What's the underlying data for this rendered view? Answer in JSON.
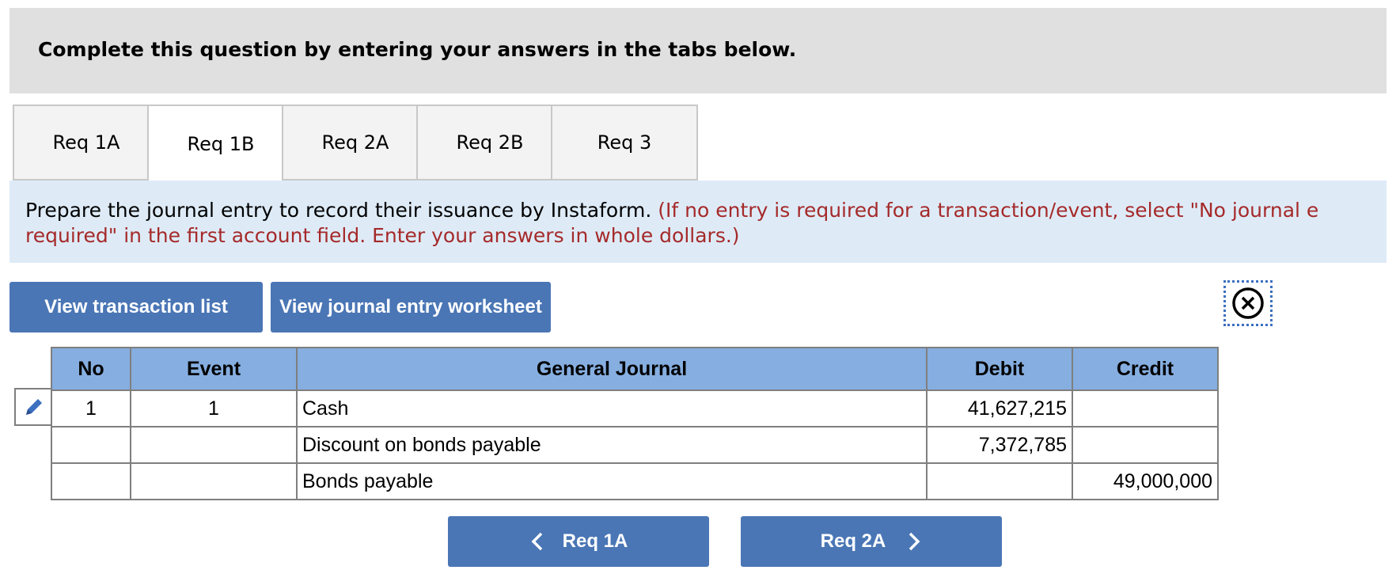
{
  "header": {
    "title": "Complete this question by entering your answers in the tabs below."
  },
  "tabs": [
    {
      "label": "Req 1A",
      "active": false
    },
    {
      "label": "Req 1B",
      "active": true
    },
    {
      "label": "Req 2A",
      "active": false
    },
    {
      "label": "Req 2B",
      "active": false
    },
    {
      "label": "Req 3",
      "active": false
    }
  ],
  "instructions": {
    "main": "Prepare the journal entry to record their issuance by Instaform.",
    "note_line1": "(If no entry is required for a transaction/event, select \"No journal e",
    "note_line2": "required\" in the first account field. Enter your answers in whole dollars.)"
  },
  "buttons": {
    "view_transaction_list": "View transaction list",
    "view_journal_worksheet": "View journal entry worksheet"
  },
  "table": {
    "headers": [
      "No",
      "Event",
      "General Journal",
      "Debit",
      "Credit"
    ],
    "rows": [
      {
        "no": "1",
        "event": "1",
        "account": "Cash",
        "debit": "41,627,215",
        "credit": ""
      },
      {
        "no": "",
        "event": "",
        "account": "Discount on bonds payable",
        "debit": "7,372,785",
        "credit": ""
      },
      {
        "no": "",
        "event": "",
        "account": "Bonds payable",
        "debit": "",
        "credit": "49,000,000"
      }
    ]
  },
  "nav": {
    "prev_label": "Req 1A",
    "next_label": "Req 2A"
  },
  "icons": {
    "edit": "pencil-icon",
    "close": "close-circle-icon",
    "prev": "chevron-left-icon",
    "next": "chevron-right-icon"
  },
  "colors": {
    "button_bg": "#4a76b5",
    "table_header_bg": "#86aee0",
    "instruction_bg": "#deebf7",
    "note_red": "#a52a2a"
  }
}
